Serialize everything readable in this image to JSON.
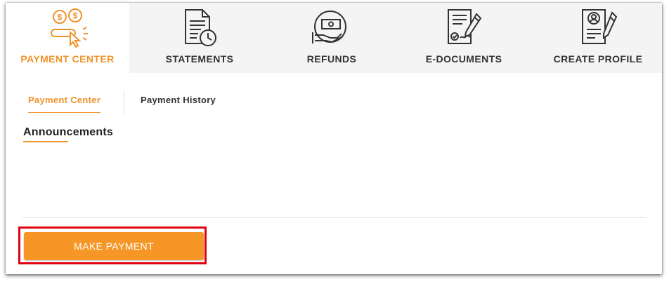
{
  "colors": {
    "accent": "#f0922a",
    "icon_dark": "#333333",
    "button_bg": "#f59626",
    "highlight_border": "#e10010"
  },
  "tabs": [
    {
      "label": "PAYMENT CENTER",
      "icon": "dollar-coins-cursor-icon",
      "active": true
    },
    {
      "label": "STATEMENTS",
      "icon": "document-clock-icon",
      "active": false
    },
    {
      "label": "REFUNDS",
      "icon": "hand-money-icon",
      "active": false
    },
    {
      "label": "E-DOCUMENTS",
      "icon": "document-signature-icon",
      "active": false
    },
    {
      "label": "CREATE PROFILE",
      "icon": "profile-document-pen-icon",
      "active": false
    }
  ],
  "subtabs": [
    {
      "label": "Payment Center",
      "active": true
    },
    {
      "label": "Payment History",
      "active": false
    }
  ],
  "main": {
    "section_title": "Announcements",
    "make_payment_label": "MAKE PAYMENT"
  }
}
